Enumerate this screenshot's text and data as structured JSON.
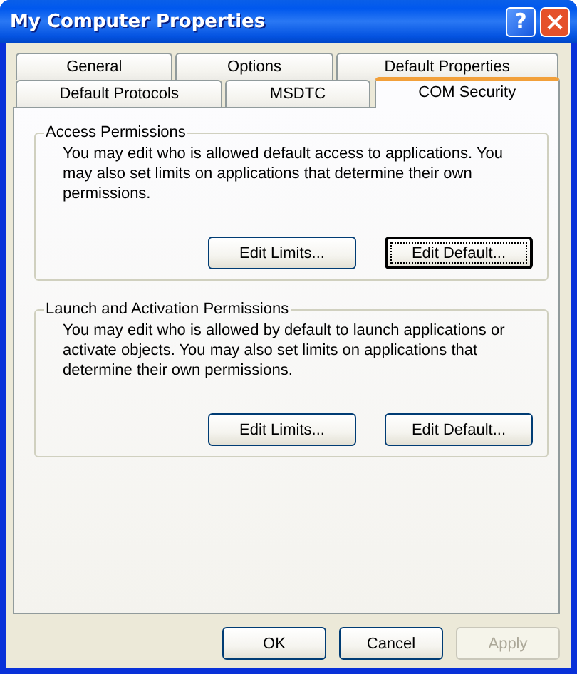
{
  "window": {
    "title": "My Computer Properties",
    "controls": [
      {
        "kind": "help",
        "label": "?"
      },
      {
        "kind": "close"
      }
    ]
  },
  "tab_rows": [
    [
      {
        "label": "General",
        "selected": false
      },
      {
        "label": "Options",
        "selected": false
      },
      {
        "label": "Default Properties",
        "selected": false
      }
    ],
    [
      {
        "label": "Default Protocols",
        "selected": false
      },
      {
        "label": "MSDTC",
        "selected": false
      },
      {
        "label": "COM Security",
        "selected": true
      }
    ]
  ],
  "groups": [
    {
      "title": "Access Permissions",
      "text": "You may edit who is allowed default access to applications. You may also set limits on applications that determine their own permissions.",
      "buttons": [
        {
          "label": "Edit Limits...",
          "focused": false
        },
        {
          "label": "Edit Default...",
          "focused": true
        }
      ]
    },
    {
      "title": "Launch and Activation Permissions",
      "text": "You may edit who is allowed by default to launch applications or activate objects. You may also set limits on applications that determine their own permissions.",
      "buttons": [
        {
          "label": "Edit Limits...",
          "focused": false
        },
        {
          "label": "Edit Default...",
          "focused": false
        }
      ]
    }
  ],
  "dialog_buttons": [
    {
      "label": "OK",
      "disabled": false
    },
    {
      "label": "Cancel",
      "disabled": false
    },
    {
      "label": "Apply",
      "disabled": true
    }
  ]
}
